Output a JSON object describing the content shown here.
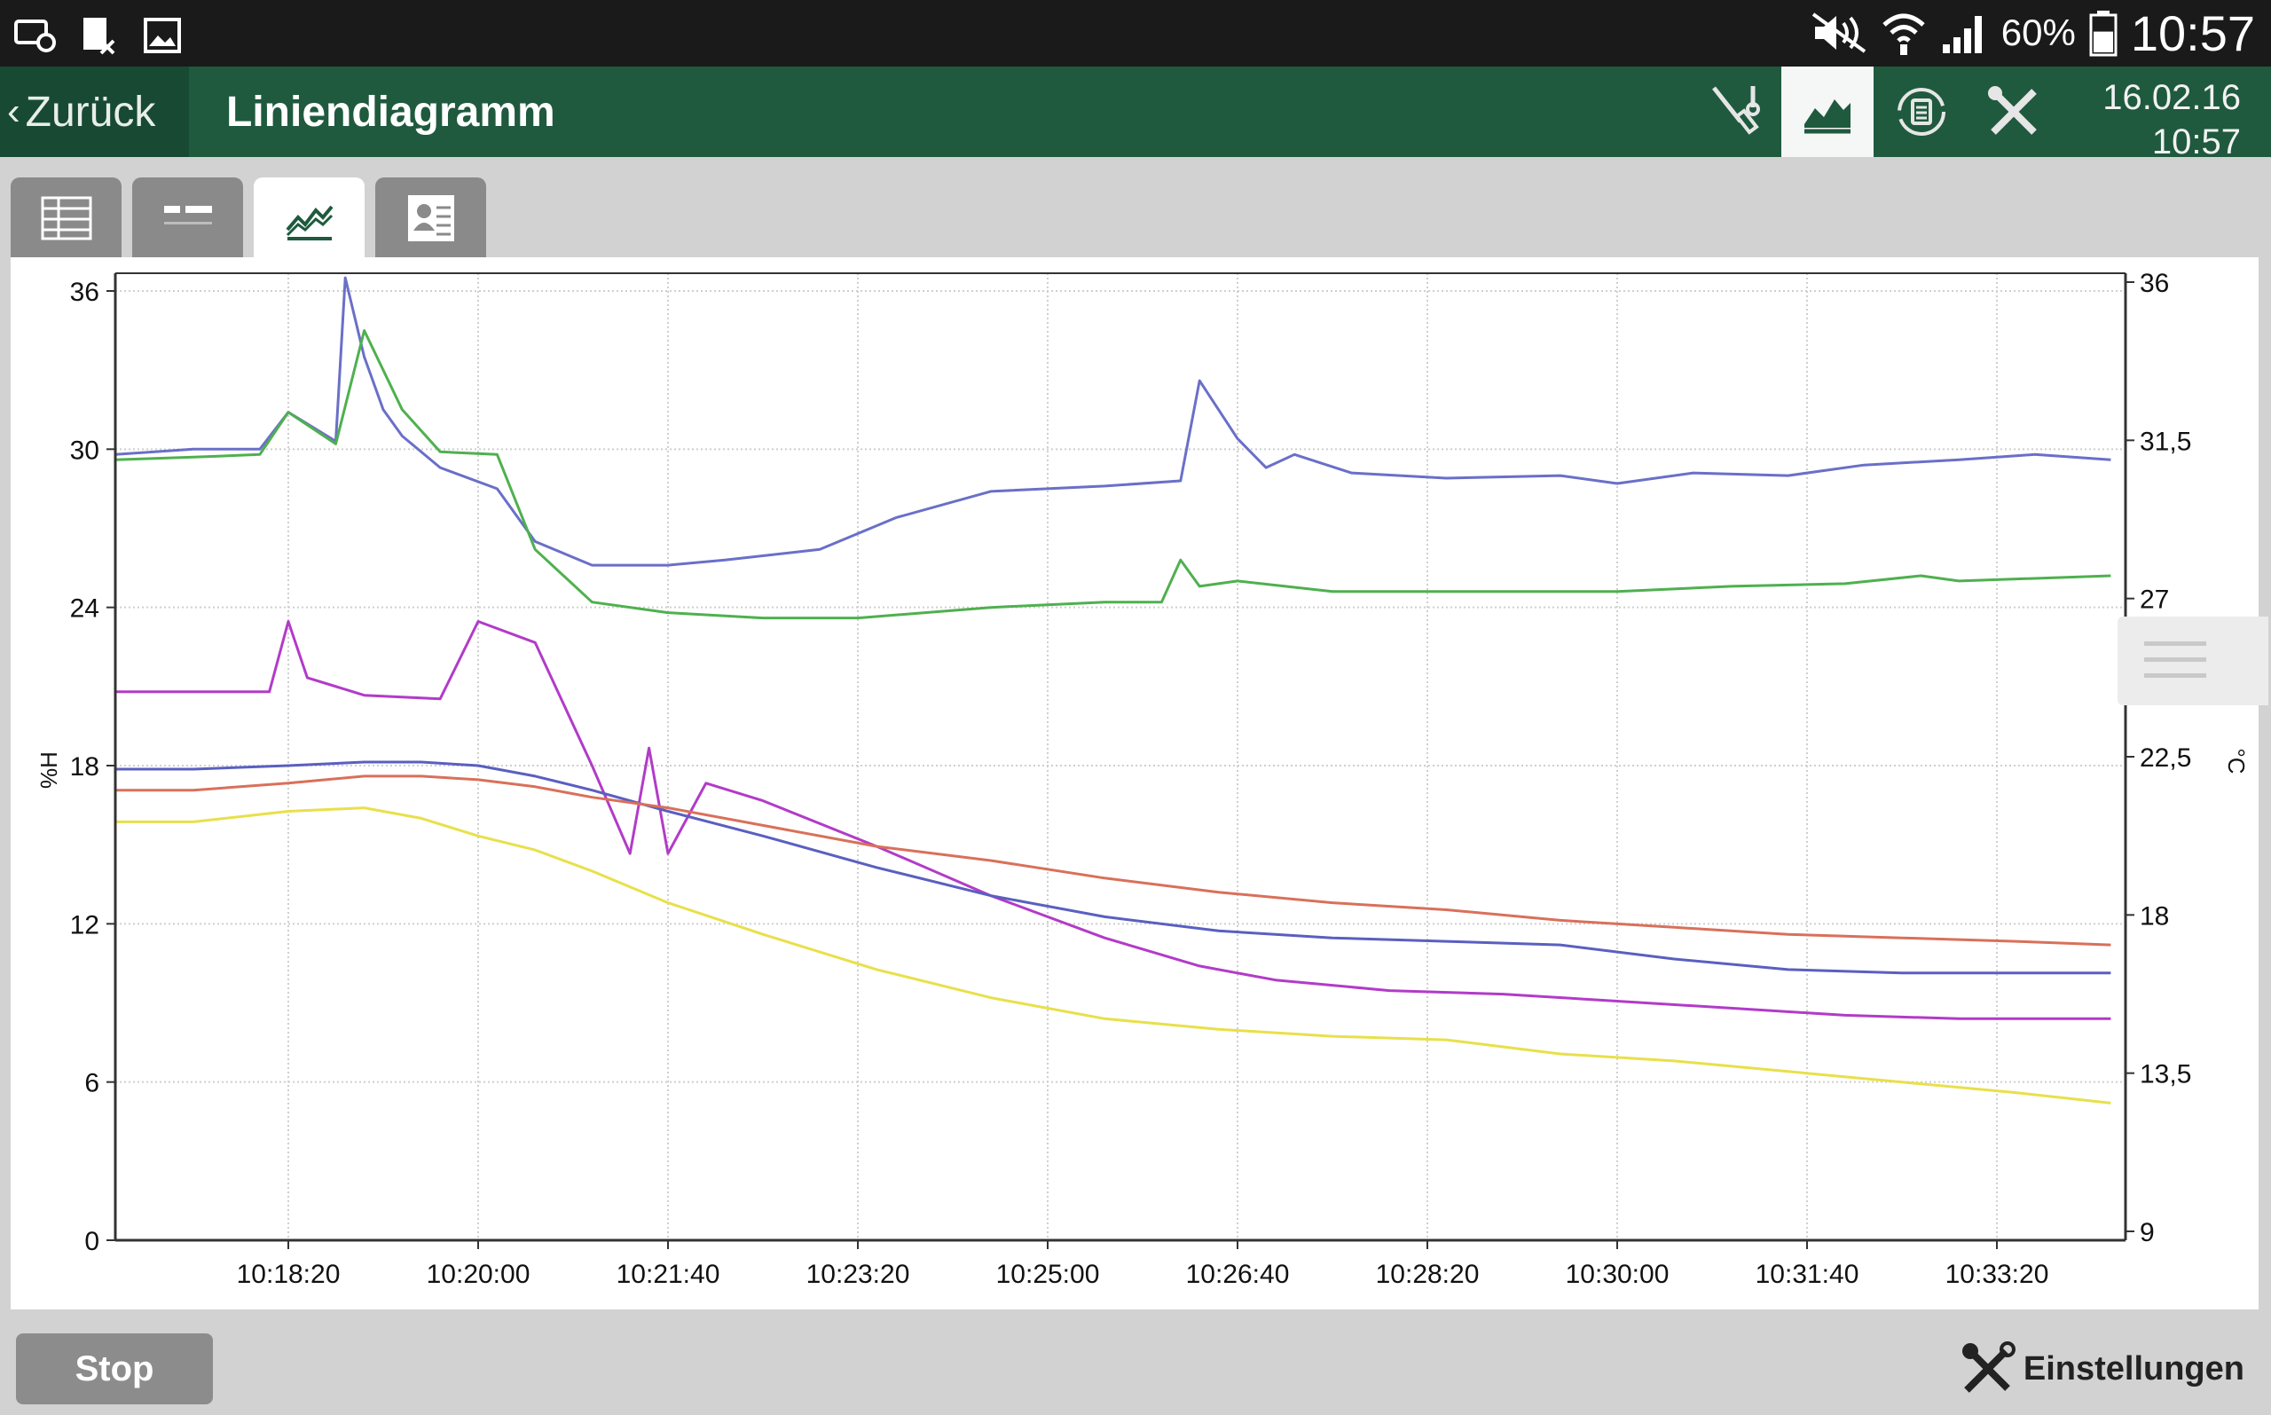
{
  "status_bar": {
    "icons_left": [
      "screen-timer-icon",
      "document-x-icon",
      "gallery-icon"
    ],
    "icons_right": [
      "mute-icon",
      "wifi-icon",
      "signal-icon"
    ],
    "battery_text": "60%",
    "battery_level": 0.6,
    "clock": "10:57"
  },
  "app_bar": {
    "back_label": "Zurück",
    "title": "Liniendiagramm",
    "toolbar_icons": [
      "probe-icon",
      "line-chart-icon",
      "refresh-icon",
      "tools-icon"
    ],
    "active_toolbar": "line-chart-icon",
    "date": "16.02.16",
    "time": "10:57"
  },
  "tabs": {
    "items": [
      "table-view-icon",
      "list-view-icon",
      "line-chart-icon",
      "report-icon"
    ],
    "active": 2
  },
  "chart_data": {
    "type": "line",
    "ylabel_left": "%H",
    "ylabel_right": "°C",
    "ylim_left": [
      0,
      36
    ],
    "ylim_right": [
      9,
      36
    ],
    "yticks_left": [
      "0",
      "6",
      "12",
      "18",
      "24",
      "30",
      "36"
    ],
    "yticks_right": [
      "9",
      "13,5",
      "18",
      "22,5",
      "27",
      "31,5",
      "36"
    ],
    "xticks": [
      "10:18:20",
      "10:20:00",
      "10:21:40",
      "10:23:20",
      "10:25:00",
      "10:26:40",
      "10:28:20",
      "10:30:00",
      "10:31:40",
      "10:33:20"
    ],
    "grid": true,
    "series": [
      {
        "color": "#6a6fc8",
        "axis": "left",
        "x": [
          "10:16:48",
          "10:17:30",
          "10:18:05",
          "10:18:20",
          "10:18:45",
          "10:18:50",
          "10:19:00",
          "10:19:10",
          "10:19:20",
          "10:19:40",
          "10:20:10",
          "10:20:30",
          "10:21:00",
          "10:21:40",
          "10:22:10",
          "10:23:00",
          "10:23:40",
          "10:24:30",
          "10:25:30",
          "10:26:10",
          "10:26:20",
          "10:26:40",
          "10:26:55",
          "10:27:10",
          "10:27:40",
          "10:28:30",
          "10:29:30",
          "10:30:00",
          "10:30:40",
          "10:31:30",
          "10:32:10",
          "10:33:00",
          "10:33:40",
          "10:34:20"
        ],
        "y": [
          29.8,
          30.0,
          30.0,
          31.4,
          30.3,
          36.5,
          33.5,
          31.5,
          30.5,
          29.3,
          28.5,
          26.5,
          25.6,
          25.6,
          25.8,
          26.2,
          27.4,
          28.4,
          28.6,
          28.8,
          32.6,
          30.4,
          29.3,
          29.8,
          29.1,
          28.9,
          29.0,
          28.7,
          29.1,
          29.0,
          29.4,
          29.6,
          29.8,
          29.6
        ]
      },
      {
        "color": "#4fb04f",
        "axis": "left",
        "x": [
          "10:16:48",
          "10:17:30",
          "10:18:05",
          "10:18:20",
          "10:18:45",
          "10:19:00",
          "10:19:20",
          "10:19:40",
          "10:20:10",
          "10:20:30",
          "10:21:00",
          "10:21:40",
          "10:22:30",
          "10:23:20",
          "10:24:30",
          "10:25:30",
          "10:26:00",
          "10:26:10",
          "10:26:20",
          "10:26:40",
          "10:27:30",
          "10:28:30",
          "10:29:30",
          "10:30:00",
          "10:31:00",
          "10:32:00",
          "10:32:40",
          "10:33:00",
          "10:34:20"
        ],
        "y": [
          29.6,
          29.7,
          29.8,
          31.4,
          30.2,
          34.5,
          31.5,
          29.9,
          29.8,
          26.2,
          24.2,
          23.8,
          23.6,
          23.6,
          24.0,
          24.2,
          24.2,
          25.8,
          24.8,
          25.0,
          24.6,
          24.6,
          24.6,
          24.6,
          24.8,
          24.9,
          25.2,
          25.0,
          25.2
        ]
      },
      {
        "color": "#b23bc8",
        "axis": "right",
        "x": [
          "10:16:48",
          "10:17:30",
          "10:18:10",
          "10:18:20",
          "10:18:30",
          "10:19:00",
          "10:19:40",
          "10:20:00",
          "10:20:30",
          "10:21:00",
          "10:21:20",
          "10:21:30",
          "10:21:40",
          "10:22:00",
          "10:22:30",
          "10:23:30",
          "10:24:30",
          "10:25:30",
          "10:26:20",
          "10:27:00",
          "10:28:00",
          "10:29:00",
          "10:30:00",
          "10:31:00",
          "10:32:00",
          "10:33:00",
          "10:34:20"
        ],
        "y": [
          24.6,
          24.6,
          24.6,
          26.6,
          25.0,
          24.5,
          24.4,
          26.6,
          26.0,
          22.5,
          20.0,
          23.0,
          20.0,
          22.0,
          21.5,
          20.2,
          18.8,
          17.6,
          16.8,
          16.4,
          16.1,
          16.0,
          15.8,
          15.6,
          15.4,
          15.3,
          15.3
        ]
      },
      {
        "color": "#5a5fc0",
        "axis": "right",
        "x": [
          "10:16:48",
          "10:17:30",
          "10:18:20",
          "10:19:00",
          "10:19:30",
          "10:20:00",
          "10:20:30",
          "10:21:00",
          "10:21:40",
          "10:22:30",
          "10:23:30",
          "10:24:30",
          "10:25:30",
          "10:26:30",
          "10:27:30",
          "10:28:30",
          "10:29:30",
          "10:30:30",
          "10:31:30",
          "10:32:30",
          "10:33:30",
          "10:34:20"
        ],
        "y": [
          22.4,
          22.4,
          22.5,
          22.6,
          22.6,
          22.5,
          22.2,
          21.8,
          21.2,
          20.5,
          19.6,
          18.8,
          18.2,
          17.8,
          17.6,
          17.5,
          17.4,
          17.0,
          16.7,
          16.6,
          16.6,
          16.6
        ]
      },
      {
        "color": "#d9705a",
        "axis": "right",
        "x": [
          "10:16:48",
          "10:17:30",
          "10:18:20",
          "10:19:00",
          "10:19:30",
          "10:20:00",
          "10:20:30",
          "10:21:00",
          "10:21:40",
          "10:22:30",
          "10:23:30",
          "10:24:30",
          "10:25:30",
          "10:26:30",
          "10:27:30",
          "10:28:30",
          "10:29:30",
          "10:30:30",
          "10:31:30",
          "10:32:30",
          "10:33:30",
          "10:34:20"
        ],
        "y": [
          21.8,
          21.8,
          22.0,
          22.2,
          22.2,
          22.1,
          21.9,
          21.6,
          21.3,
          20.8,
          20.2,
          19.8,
          19.3,
          18.9,
          18.6,
          18.4,
          18.1,
          17.9,
          17.7,
          17.6,
          17.5,
          17.4
        ]
      },
      {
        "color": "#e8e04a",
        "axis": "right",
        "x": [
          "10:16:48",
          "10:17:30",
          "10:18:20",
          "10:19:00",
          "10:19:30",
          "10:20:00",
          "10:20:30",
          "10:21:00",
          "10:21:40",
          "10:22:30",
          "10:23:30",
          "10:24:30",
          "10:25:30",
          "10:26:30",
          "10:27:30",
          "10:28:30",
          "10:29:30",
          "10:30:30",
          "10:31:30",
          "10:32:30",
          "10:33:30",
          "10:34:20"
        ],
        "y": [
          20.9,
          20.9,
          21.2,
          21.3,
          21.0,
          20.5,
          20.1,
          19.5,
          18.6,
          17.7,
          16.7,
          15.9,
          15.3,
          15.0,
          14.8,
          14.7,
          14.3,
          14.1,
          13.8,
          13.5,
          13.2,
          12.9
        ]
      }
    ]
  },
  "bottom_bar": {
    "stop_label": "Stop",
    "settings_label": "Einstellungen"
  }
}
